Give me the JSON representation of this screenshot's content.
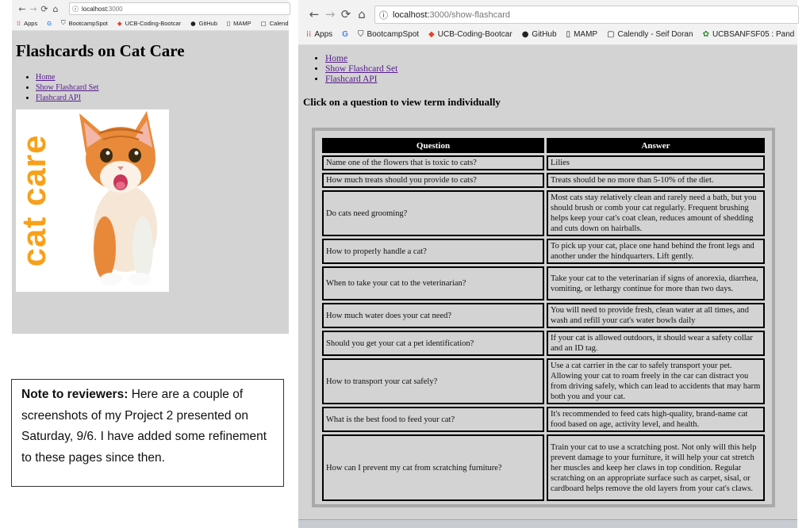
{
  "left_window": {
    "url_host": "localhost:",
    "url_path": "3000",
    "bookmarks": [
      "Apps",
      "G",
      "BootcampSpot",
      "UCB-Coding-Bootcar",
      "GitHub",
      "MAMP",
      "Calendly -"
    ],
    "heading": "Flashcards on Cat Care",
    "nav_links": [
      "Home",
      "Show Flashcard Set",
      "Flashcard API"
    ],
    "image_text": "cat care",
    "image_text_color": "#f7a11a"
  },
  "note": {
    "bold": "Note to reviewers:",
    "text": " Here are a couple of screenshots of my Project 2 presented on Saturday, 9/6. I have added some refinement to these pages since then."
  },
  "right_window": {
    "url_host": "localhost:",
    "url_path": "3000/show-flashcard",
    "bookmarks": [
      "Apps",
      "G",
      "BootcampSpot",
      "UCB-Coding-Bootcar",
      "GitHub",
      "MAMP",
      "Calendly - Seif Doran",
      "UCBSANFSF05 : Pand"
    ],
    "nav_links": [
      "Home",
      "Show Flashcard Set",
      "Flashcard API"
    ],
    "instruction": "Click on a question to view term individually",
    "table": {
      "headers": [
        "Question",
        "Answer"
      ],
      "rows": [
        {
          "q": "Name one of the flowers that is toxic to cats?",
          "a": "Lilies"
        },
        {
          "q": "How much treats should you provide to cats?",
          "a": "Treats should be no more than 5-10% of the diet."
        },
        {
          "q": "Do cats need grooming?",
          "a": "Most cats stay relatively clean and rarely need a bath, but you should brush or comb your cat regularly. Frequent brushing helps keep your cat's coat clean, reduces amount of shedding and cuts down on hairballs."
        },
        {
          "q": "How to properly handle a cat?",
          "a": "To pick up your cat, place one hand behind the front legs and another under the hindquarters. Lift gently."
        },
        {
          "q": "When to take your cat to the veterinarian?",
          "a": "Take your cat to the veterinarian if signs of anorexia, diarrhea, vomiting, or lethargy continue for more than two days."
        },
        {
          "q": "How much water does your cat need?",
          "a": "You will need to provide fresh, clean water at all times, and wash and refill your cat's water bowls daily"
        },
        {
          "q": "Should you get your cat a pet identification?",
          "a": "If your cat is allowed outdoors, it should wear a safety collar and an ID tag."
        },
        {
          "q": "How to transport your cat safely?",
          "a": "Use a cat carrier in the car to safely transport your pet. Allowing your cat to roam freely in the car can distract you from driving safely, which can lead to accidents that may harm both you and your cat."
        },
        {
          "q": "What is the best food to feed your cat?",
          "a": "It's recommended to feed cats high-quality, brand-name cat food based on age, activity level, and health."
        },
        {
          "q": "How can I prevent my cat from scratching furniture?",
          "a": "Train your cat to use a scratching post. Not only will this help prevent damage to your furniture, it will help your cat stretch her muscles and keep her claws in top condition. Regular scratching on an appropriate surface such as carpet, sisal, or cardboard helps remove the old layers from your cat's claws."
        }
      ]
    }
  }
}
